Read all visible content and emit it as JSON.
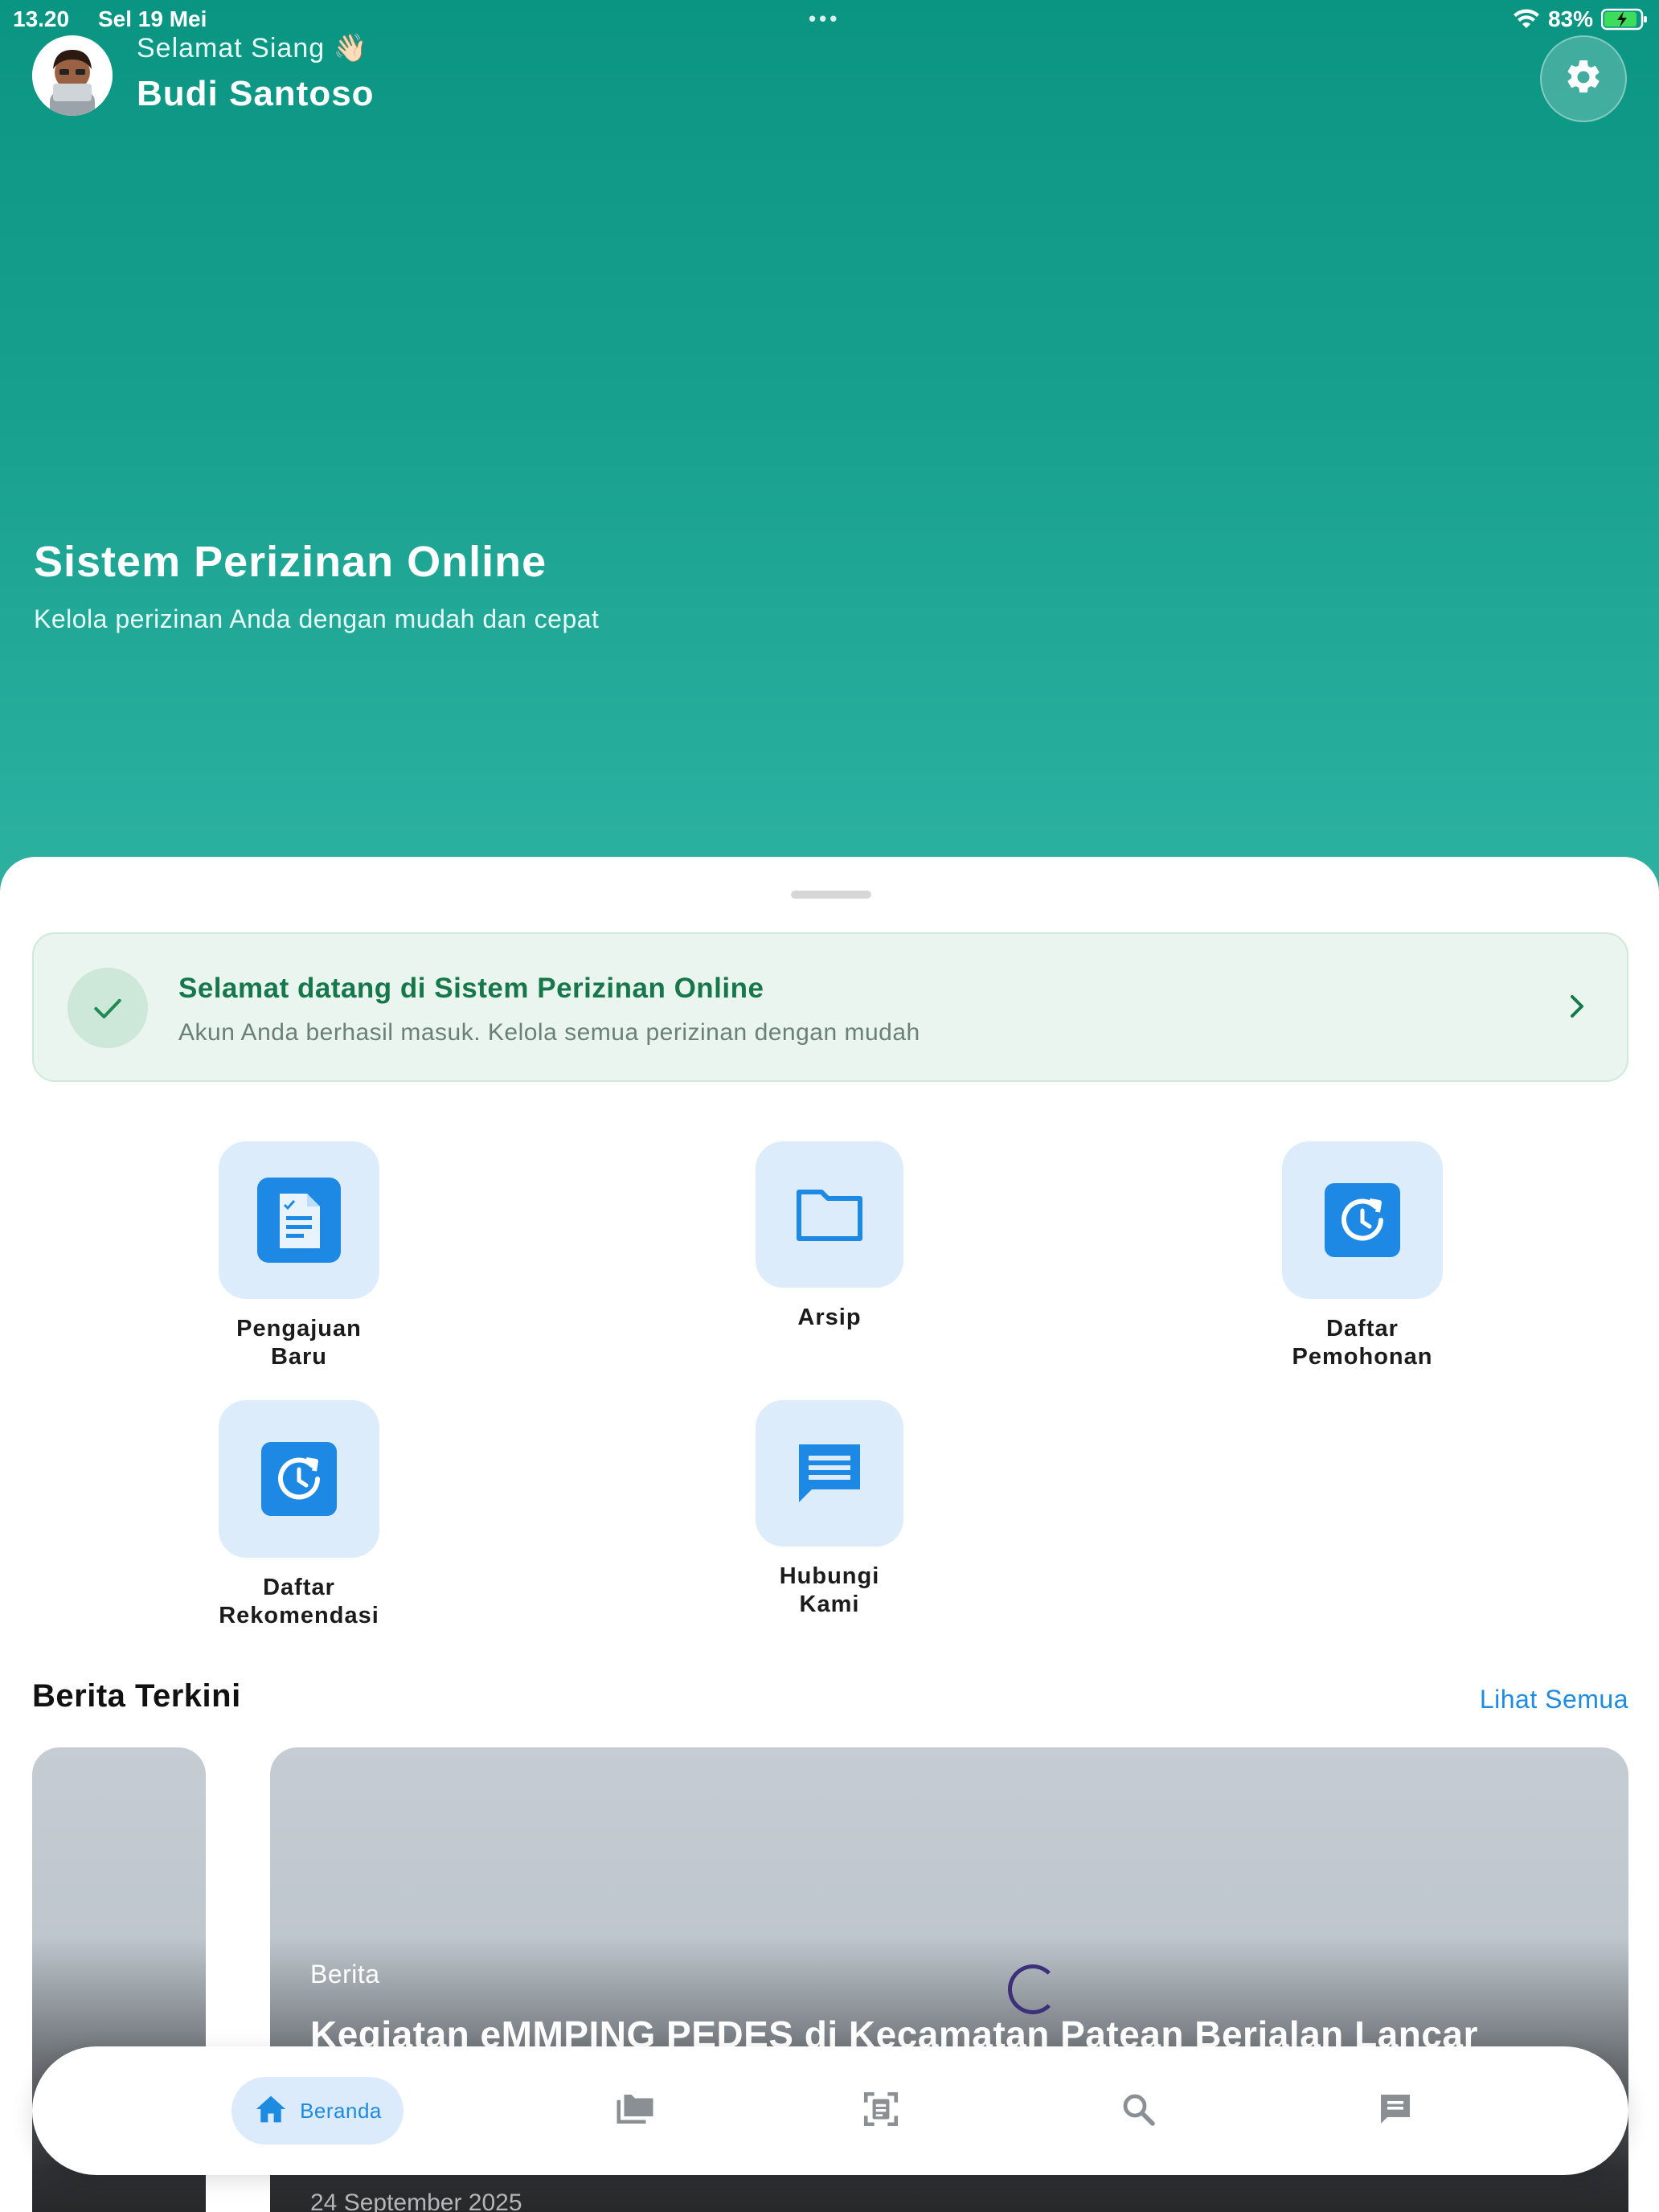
{
  "status_bar": {
    "time": "13.20",
    "date": "Sel 19 Mei",
    "dots": "•••",
    "battery": "83%"
  },
  "header": {
    "greeting": "Selamat Siang 👋🏻",
    "user_name": "Budi Santoso",
    "settings_icon": "gear-icon"
  },
  "hero": {
    "title": "Sistem Perizinan Online",
    "subtitle": "Kelola perizinan Anda dengan mudah dan cepat"
  },
  "welcome_banner": {
    "title": "Selamat datang di Sistem Perizinan Online",
    "text": "Akun Anda berhasil masuk. Kelola semua perizinan dengan mudah",
    "icon": "check-icon"
  },
  "menu": {
    "items": [
      {
        "label_line1": "Pengajuan",
        "label_line2": "Baru",
        "icon": "new-document-icon"
      },
      {
        "label_line1": "Arsip",
        "label_line2": "",
        "icon": "folder-icon"
      },
      {
        "label_line1": "Daftar",
        "label_line2": "Pemohonan",
        "icon": "history-icon"
      },
      {
        "label_line1": "Daftar",
        "label_line2": "Rekomendasi",
        "icon": "history-icon"
      },
      {
        "label_line1": "Hubungi",
        "label_line2": "Kami",
        "icon": "message-icon"
      }
    ]
  },
  "news": {
    "section_title": "Berita Terkini",
    "see_all": "Lihat Semua",
    "featured": {
      "category": "Berita",
      "title": "Kegiatan eMMPING PEDES di Kecamatan Patean Berjalan Lancar",
      "date": "24 September 2025"
    }
  },
  "bottom_nav": {
    "items": [
      {
        "label": "Beranda",
        "icon": "home-icon",
        "active": true
      },
      {
        "label": "",
        "icon": "folder-stack-icon",
        "active": false
      },
      {
        "label": "",
        "icon": "scan-document-icon",
        "active": false
      },
      {
        "label": "",
        "icon": "search-icon",
        "active": false
      },
      {
        "label": "",
        "icon": "chat-icon",
        "active": false
      }
    ]
  },
  "colors": {
    "hero_top": "#0a9582",
    "hero_bottom": "#2db2a2",
    "accent_blue": "#1d8be0",
    "success_green": "#16784a",
    "tile_bg": "#dcecfb"
  }
}
